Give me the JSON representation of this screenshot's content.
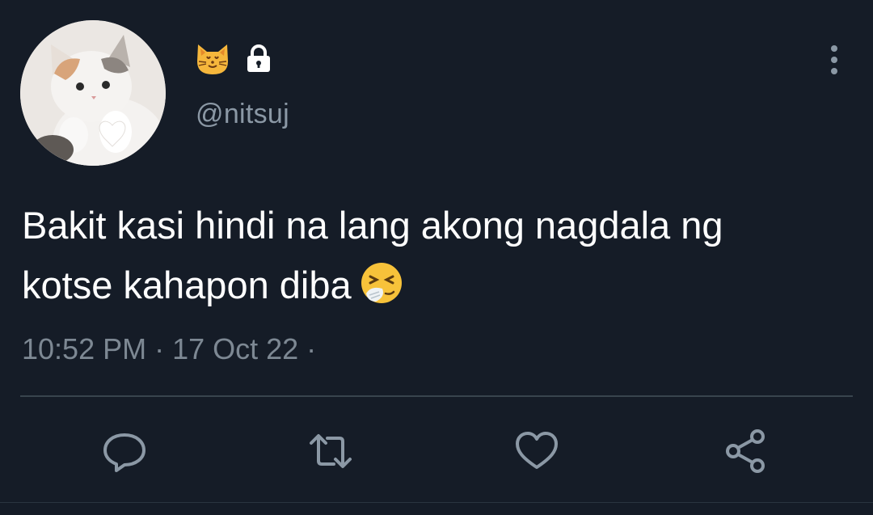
{
  "author": {
    "display_name_emoji": "cat-face-emoji",
    "protected": true,
    "handle": "@nitsuj",
    "avatar": "cat-photo-avatar"
  },
  "tweet": {
    "text_line_1": "Bakit kasi hindi na lang akong nagdala ng",
    "text_line_2": "kotse kahapon diba",
    "emoji": "sneezing-face-emoji",
    "timestamp": "10:52 PM · 17 Oct 22 ·"
  },
  "actions": [
    {
      "name": "reply",
      "icon": "speech-bubble-icon"
    },
    {
      "name": "retweet",
      "icon": "retweet-arrows-icon"
    },
    {
      "name": "like",
      "icon": "heart-icon"
    },
    {
      "name": "share",
      "icon": "share-nodes-icon"
    }
  ],
  "colors": {
    "background": "#151c27",
    "primary_text": "#ffffff",
    "secondary_text": "#8b98a5",
    "icon": "#8b98a5",
    "divider": "#38444d"
  }
}
